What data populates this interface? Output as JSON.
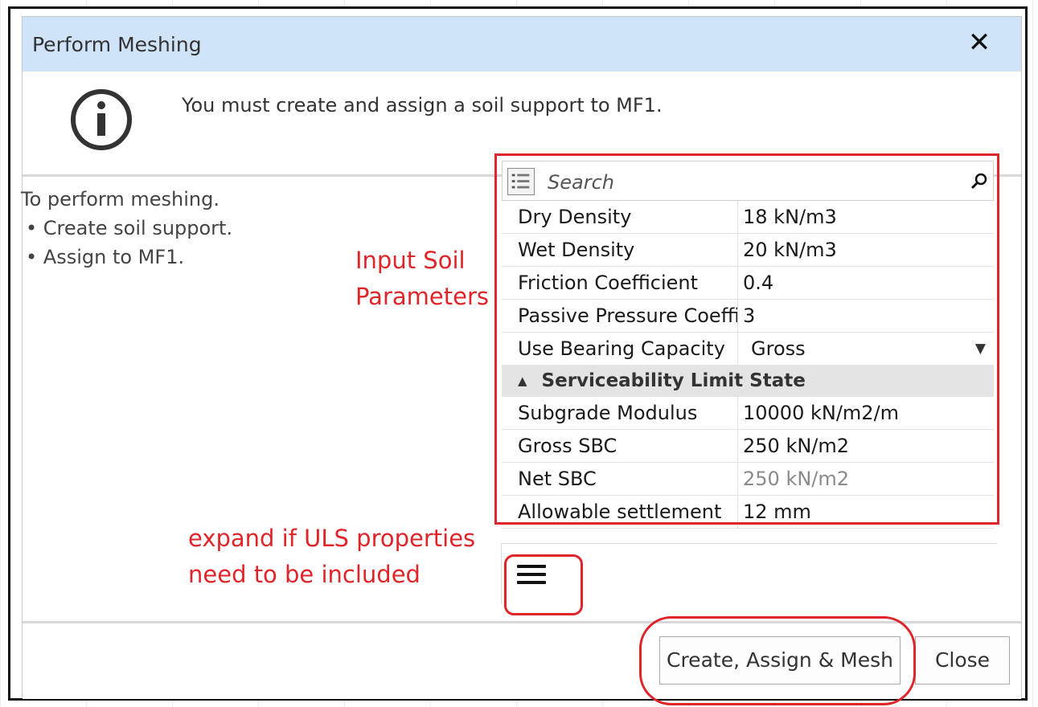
{
  "dialog": {
    "title": "Perform Meshing",
    "close_glyph": "✕",
    "message": "You must create and assign a soil support to MF1."
  },
  "instructions": {
    "heading": "To perform meshing.",
    "steps": [
      "• Create soil support.",
      "• Assign to MF1."
    ]
  },
  "annotations": {
    "input_soil_line1": "Input Soil",
    "input_soil_line2": "Parameters",
    "expand_line1": "expand if ULS properties",
    "expand_line2": "need to be included"
  },
  "property_grid": {
    "search_placeholder": "Search",
    "rows": [
      {
        "name": "Dry Density",
        "value": "18 kN/m3"
      },
      {
        "name": "Wet Density",
        "value": "20 kN/m3"
      },
      {
        "name": "Friction Coefficient",
        "value": "0.4"
      },
      {
        "name": "Passive Pressure Coeffici",
        "value": "3"
      },
      {
        "name": "Use Bearing Capacity",
        "value": "Gross"
      }
    ],
    "section_title": "Serviceability Limit State",
    "section_rows": [
      {
        "name": "Subgrade Modulus",
        "value": "10000 kN/m2/m"
      },
      {
        "name": "Gross SBC",
        "value": "250 kN/m2"
      },
      {
        "name": "Net SBC",
        "value": "250 kN/m2"
      },
      {
        "name": "Allowable settlement",
        "value": "12 mm"
      }
    ]
  },
  "buttons": {
    "create": "Create, Assign & Mesh",
    "close": "Close"
  },
  "icons": [
    "info-icon",
    "close-icon",
    "list-view-icon",
    "search-icon",
    "chevron-down-icon",
    "collapse-caret-icon",
    "hamburger-menu-icon"
  ],
  "colors": {
    "titlebar": "#cfe3f9",
    "annotation_red": "#e0252a",
    "section_bg": "#e4e4e4"
  }
}
